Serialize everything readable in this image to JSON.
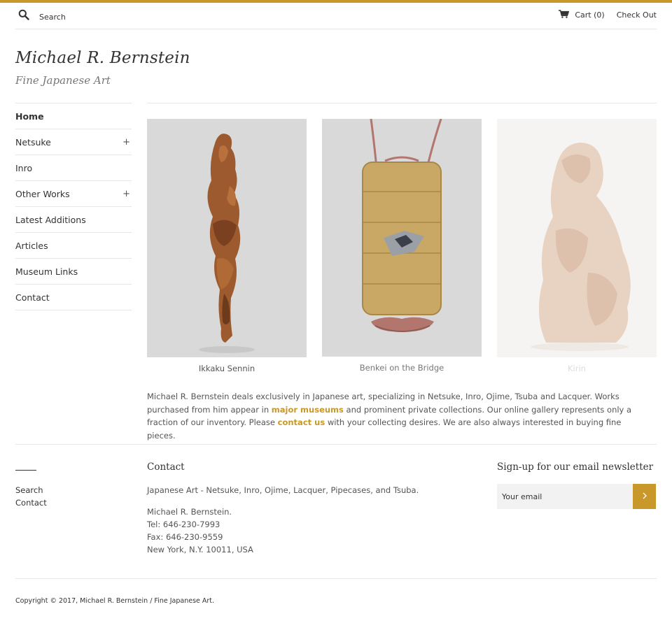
{
  "colors": {
    "accent": "#c9982b",
    "text": "#333333",
    "muted": "#555555",
    "rule": "#e6e6e6"
  },
  "header": {
    "search_placeholder": "Search",
    "search_icon": "search-icon",
    "cart_icon": "cart-icon",
    "cart_label": "Cart",
    "cart_count": "(0)",
    "checkout_label": "Check Out"
  },
  "brand": {
    "title": "Michael R. Bernstein",
    "tagline": "Fine Japanese Art"
  },
  "sidebar": {
    "items": [
      {
        "label": "Home",
        "expand": ""
      },
      {
        "label": "Netsuke",
        "expand": "+"
      },
      {
        "label": "Inro",
        "expand": ""
      },
      {
        "label": "Other Works",
        "expand": "+"
      },
      {
        "label": "Latest Additions",
        "expand": ""
      },
      {
        "label": "Articles",
        "expand": ""
      },
      {
        "label": "Museum Links",
        "expand": ""
      },
      {
        "label": "Contact",
        "expand": ""
      }
    ]
  },
  "products": [
    {
      "caption": "Ikkaku Sennin"
    },
    {
      "caption": "Benkei on the Bridge"
    },
    {
      "caption": "Kirin"
    }
  ],
  "intro": {
    "part1": "Michael R. Bernstein deals exclusively in Japanese art, specializing in Netsuke, Inro, Ojime, Tsuba and Lacquer. Works purchased from him appear in ",
    "link1": "major museums",
    "part2": " and prominent private collections. Our online gallery represents only a fraction of our inventory. Please ",
    "link2": "contact us",
    "part3": " with your collecting desires. We are also always interested in buying fine pieces."
  },
  "footer": {
    "links": [
      "Search",
      "Contact"
    ],
    "contact_title": "Contact",
    "contact_desc": "Japanese Art - Netsuke, Inro, Ojime, Lacquer, Pipecases, and Tsuba.",
    "contact_lines": [
      "Michael R. Bernstein.",
      "Tel: 646-230-7993",
      "Fax: 646-230-9559",
      "New York, N.Y. 10011, USA"
    ],
    "newsletter_title": "Sign-up for our email newsletter",
    "newsletter_placeholder": "Your email",
    "submit_icon": "chevron-right-icon",
    "copyright": "Copyright © 2017, Michael R. Bernstein / Fine Japanese Art."
  }
}
